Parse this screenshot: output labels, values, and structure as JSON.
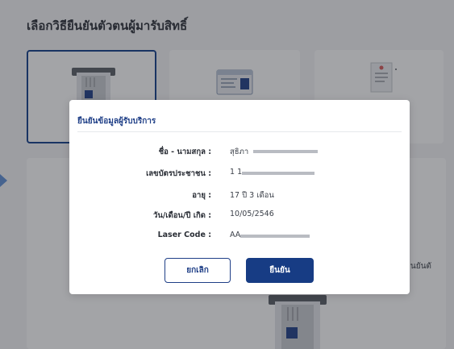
{
  "page": {
    "title": "เลือกวิธียืนยันตัวตนผู้มารับสิทธิ์",
    "side_text": "การยืนยันตั"
  },
  "modal": {
    "title": "ยืนยันข้อมูลผู้รับบริการ",
    "fields": [
      {
        "label": "ชื่อ - นามสกุล :",
        "value": "สุธิภา"
      },
      {
        "label": "เลขบัตรประชาชน :",
        "value": "1 1"
      },
      {
        "label": "อายุ :",
        "value": "17 ปี 3 เดือน"
      },
      {
        "label": "วัน/เดือน/ปี เกิด :",
        "value": "10/05/2546"
      },
      {
        "label": "Laser Code :",
        "value": "AA"
      }
    ],
    "cancel_label": "ยกเลิก",
    "confirm_label": "ยืนยัน"
  },
  "colors": {
    "brand": "#173c84",
    "selected_border": "#123f8a",
    "arrow": "#5f8fd6"
  },
  "icons": [
    "card-reader-icon",
    "id-card-icon",
    "document-icon",
    "card-reader-icon"
  ]
}
